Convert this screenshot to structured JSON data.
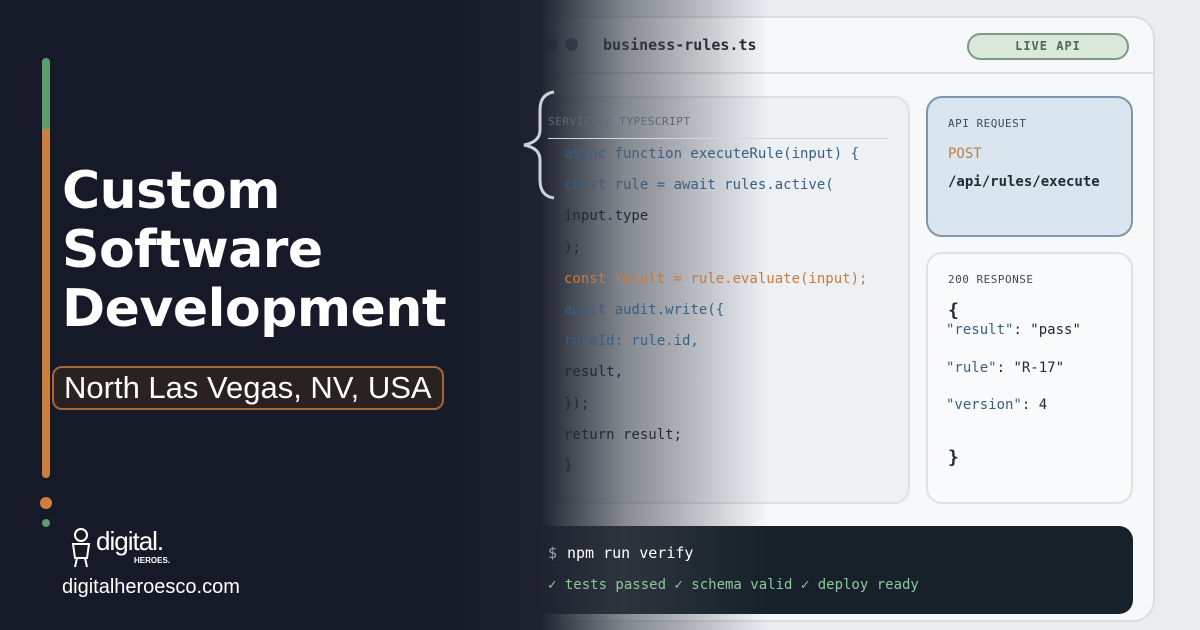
{
  "headline": [
    "Custom",
    "Software",
    "Development"
  ],
  "location": "North Las Vegas, NV, USA",
  "brand": {
    "logo_word": "digital.",
    "logo_sub": "HEROES.",
    "website": "digitalheroesco.com"
  },
  "editor": {
    "filename": "business-rules.ts",
    "status_pill": "LIVE API",
    "code_label": "SERVICE / TYPESCRIPT",
    "code_lines": [
      {
        "text": "async function executeRule(input) {",
        "color": "#3a5f80"
      },
      {
        "text": "const rule = await rules.active(",
        "color": "#3a5f80"
      },
      {
        "text": "input.type",
        "color": "#1f2a33"
      },
      {
        "text": ");",
        "color": "#1f2a33"
      },
      {
        "text": "const result = rule.evaluate(input);",
        "color": "#c77a3c"
      },
      {
        "text": "await audit.write({",
        "color": "#3a5f80"
      },
      {
        "text": "ruleId: rule.id,",
        "color": "#3a5f80"
      },
      {
        "text": "result,",
        "color": "#1f2a33"
      },
      {
        "text": "});",
        "color": "#1f2a33"
      },
      {
        "text": "return result;",
        "color": "#1f2a33"
      },
      {
        "text": "}",
        "color": "#1f2a33"
      }
    ]
  },
  "request": {
    "label": "API REQUEST",
    "method": "POST",
    "path": "/api/rules/execute"
  },
  "response": {
    "label": "200 RESPONSE",
    "open_brace": "{",
    "close_brace": "}",
    "fields": [
      {
        "key": "\"result\"",
        "sep": ": ",
        "value": "\"pass\""
      },
      {
        "key": "\"rule\"",
        "sep": ": ",
        "value": "\"R-17\""
      },
      {
        "key": "\"version\"",
        "sep": ": ",
        "value": "4"
      }
    ]
  },
  "terminal": {
    "prompt": "$",
    "command": "npm run verify",
    "output": "✓ tests passed ✓ schema valid ✓ deploy ready"
  },
  "colors": {
    "accent_green": "#5d9c6b",
    "accent_orange": "#cf7f3d",
    "bg_dark": "#161a28",
    "terminal_green": "#8bc99a"
  }
}
